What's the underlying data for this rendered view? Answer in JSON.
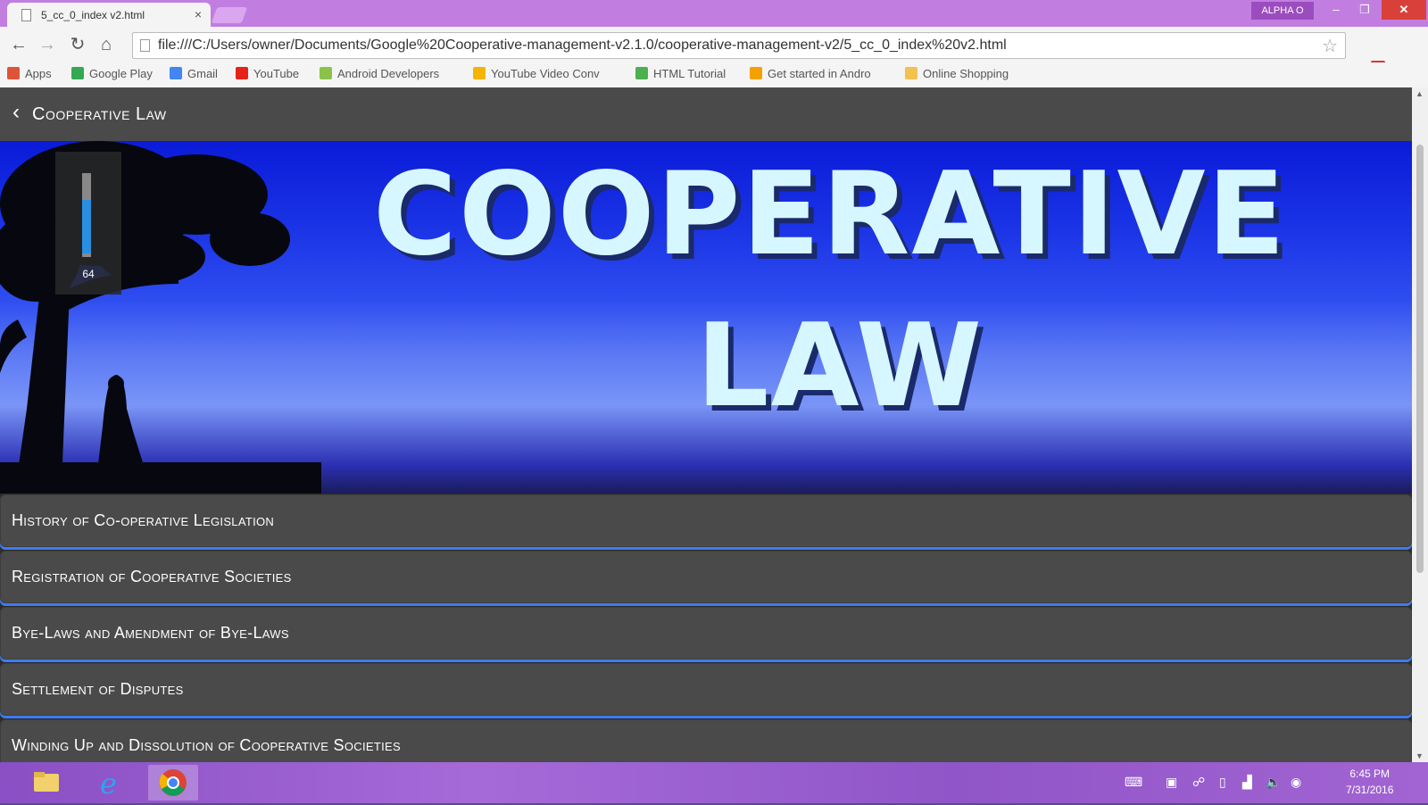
{
  "browser": {
    "tab_title": "5_cc_0_index v2.html",
    "tab_close": "×",
    "profile": "ALPHA O",
    "window_min": "–",
    "window_max": "❐",
    "window_close": "✕",
    "url": "file:///C:/Users/owner/Documents/Google%20Cooperative-management-v2.1.0/cooperative-management-v2/5_cc_0_index%20v2.html",
    "bookmarks": [
      {
        "label": "Apps",
        "icon": "apps-icon",
        "color": "#e0533b"
      },
      {
        "label": "Google Play",
        "icon": "play-icon",
        "color": "#34a853"
      },
      {
        "label": "Gmail",
        "icon": "google-icon",
        "color": "#4285f4"
      },
      {
        "label": "YouTube",
        "icon": "youtube-icon",
        "color": "#e62117"
      },
      {
        "label": "Android Developers",
        "icon": "android-icon",
        "color": "#8bc34a"
      },
      {
        "label": "YouTube Video Conv",
        "icon": "folder-icon",
        "color": "#f5b400"
      },
      {
        "label": "HTML Tutorial",
        "icon": "html-icon",
        "color": "#4caf50"
      },
      {
        "label": "Get started in Andro",
        "icon": "flame-icon",
        "color": "#f5a000"
      },
      {
        "label": "Online Shopping",
        "icon": "folder-icon",
        "color": "#f2c14e"
      }
    ]
  },
  "app": {
    "title": "Cooperative Law",
    "hero_line1": "COOPERATIVE",
    "hero_line2": "LAW",
    "items": [
      "History of Co-operative Legislation",
      "Registration of Cooperative Societies",
      "Bye-Laws and Amendment of Bye-Laws",
      "Settlement of Disputes",
      "Winding Up and Dissolution of Cooperative Societies"
    ]
  },
  "volume": {
    "label": "64",
    "level": 0.64
  },
  "taskbar": {
    "time": "6:45 PM",
    "date": "7/31/2016"
  },
  "colors": {
    "accent": "#3d7cf0",
    "title_bar": "#c17ee0",
    "app_bar": "#4a4a4a"
  }
}
